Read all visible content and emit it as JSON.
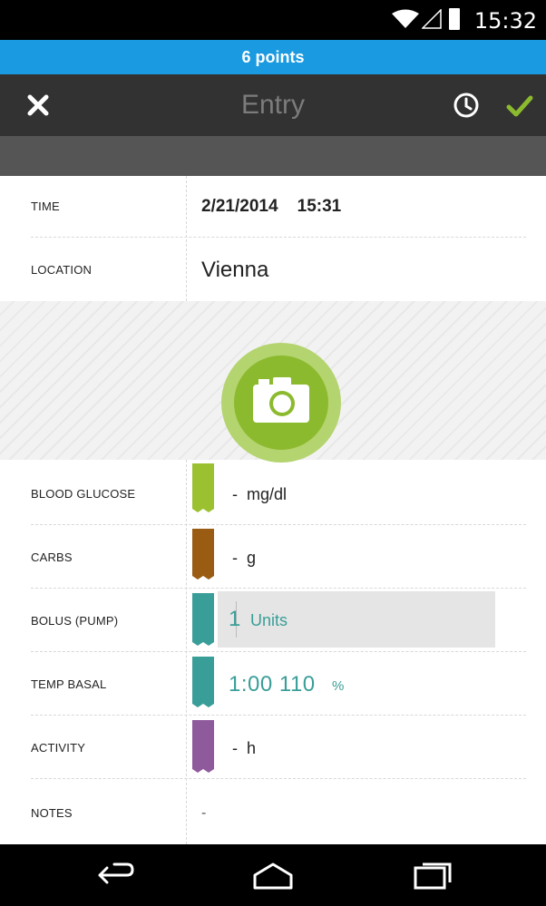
{
  "status_bar": {
    "time": "15:32",
    "icons": [
      "wifi-icon",
      "signal-icon",
      "battery-icon"
    ]
  },
  "banner": {
    "points": "6 points",
    "color": "#1a9ae0"
  },
  "action_bar": {
    "title": "Entry",
    "close_icon": "close-icon",
    "history_icon": "clock-icon",
    "confirm_icon": "check-icon",
    "accent": "#8cba2e"
  },
  "fields": {
    "time": {
      "label": "TIME",
      "date": "2/21/2014",
      "time": "15:31"
    },
    "location": {
      "label": "LOCATION",
      "value": "Vienna"
    },
    "photo": {
      "icon": "camera-icon"
    },
    "blood_glucose": {
      "label": "BLOOD GLUCOSE",
      "value": "-",
      "unit": "mg/dl",
      "color": "#9bc131"
    },
    "carbs": {
      "label": "CARBS",
      "value": "-",
      "unit": "g",
      "color": "#9a5b12"
    },
    "bolus": {
      "label": "BOLUS (PUMP)",
      "value": "1",
      "unit": "Units",
      "color": "#3a9e98"
    },
    "temp_basal": {
      "label": "TEMP BASAL",
      "duration": "1:00",
      "value": "110",
      "unit": "%",
      "color": "#3a9e98"
    },
    "activity": {
      "label": "ACTIVITY",
      "value": "-",
      "unit": "h",
      "color": "#8f5a9c"
    },
    "notes": {
      "label": "NOTES",
      "value": "-"
    }
  },
  "nav_bar": {
    "icons": [
      "back-icon",
      "home-icon",
      "recents-icon"
    ]
  }
}
